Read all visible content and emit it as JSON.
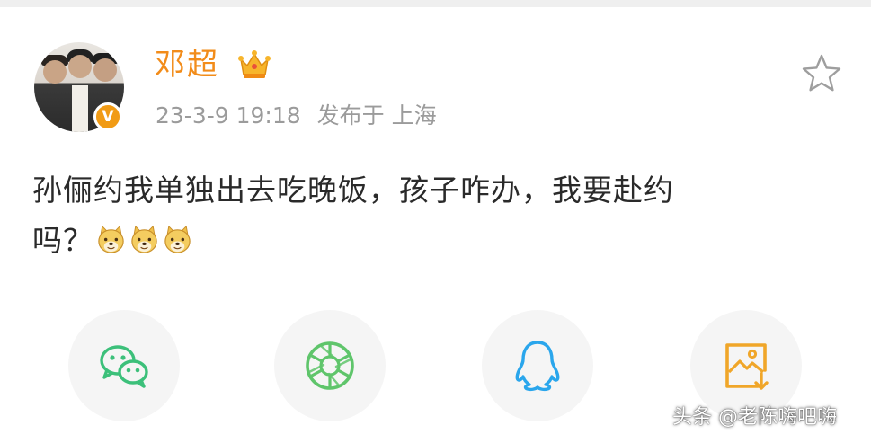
{
  "post": {
    "author": "邓超",
    "timestamp": "23-3-9 19:18",
    "location": "发布于 上海",
    "verified_badge": "V",
    "text_line1": "孙俪约我单独出去吃晚饭，孩子咋办，我要赴约",
    "text_line2": "吗？",
    "emojis": [
      "doge-emoji",
      "doge-emoji",
      "doge-emoji"
    ]
  },
  "share": {
    "targets": [
      "wechat-icon",
      "moments-icon",
      "qq-icon",
      "save-image-icon"
    ]
  },
  "watermark": "头条 @老陈嗨吧嗨",
  "colors": {
    "author": "#f28c1a",
    "meta": "#9b9b9b",
    "wechat": "#3cc07a",
    "moments": "#5fc56b",
    "qq": "#2aa6ec",
    "save": "#f0a629"
  }
}
